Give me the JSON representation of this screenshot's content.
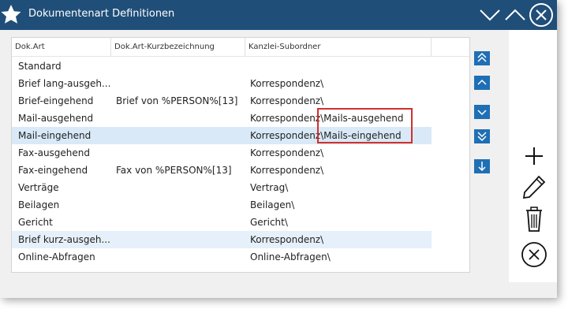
{
  "window": {
    "title": "Dokumentenart Definitionen"
  },
  "colors": {
    "titlebar": "#1f4e79",
    "accent": "#1f6fb5",
    "highlight": "#d32f2f",
    "selected_row": "#d9e9f7"
  },
  "icons": {
    "app": "star-icon",
    "minimize": "chevron-down-icon",
    "maximize": "chevron-up-icon",
    "close": "close-circle-icon"
  },
  "table": {
    "columns": [
      "Dok.Art",
      "Dok.Art-Kurzbezeichnung",
      "Kanzlei-Subordner"
    ],
    "rows": [
      {
        "dokart": "Standard",
        "kurz": "",
        "ordner": ""
      },
      {
        "dokart": "Brief lang-ausgeh...",
        "kurz": "",
        "ordner": "Korrespondenz\\"
      },
      {
        "dokart": "Brief-eingehend",
        "kurz": "Brief von %PERSON%[13]",
        "ordner": "Korrespondenz\\"
      },
      {
        "dokart": "Mail-ausgehend",
        "kurz": "",
        "ordner": "Korrespondenz\\Mails-ausgehend"
      },
      {
        "dokart": "Mail-eingehend",
        "kurz": "",
        "ordner": "Korrespondenz\\Mails-eingehend"
      },
      {
        "dokart": "Fax-ausgehend",
        "kurz": "",
        "ordner": "Korrespondenz\\"
      },
      {
        "dokart": "Fax-eingehend",
        "kurz": "Fax von %PERSON%[13]",
        "ordner": "Korrespondenz\\"
      },
      {
        "dokart": "Verträge",
        "kurz": "",
        "ordner": "Vertrag\\"
      },
      {
        "dokart": "Beilagen",
        "kurz": "",
        "ordner": "Beilagen\\"
      },
      {
        "dokart": "Gericht",
        "kurz": "",
        "ordner": "Gericht\\"
      },
      {
        "dokart": "Brief kurz-ausgeh...",
        "kurz": "",
        "ordner": "Korrespondenz\\"
      },
      {
        "dokart": "Online-Abfragen",
        "kurz": "",
        "ordner": "Online-Abfragen\\"
      }
    ]
  },
  "nav_buttons": [
    "move-top-icon",
    "move-up-icon",
    "move-down-icon",
    "move-bottom-icon",
    "sort-icon"
  ],
  "actions": [
    "plus-icon",
    "pencil-icon",
    "trash-icon",
    "cancel-circle-icon"
  ]
}
